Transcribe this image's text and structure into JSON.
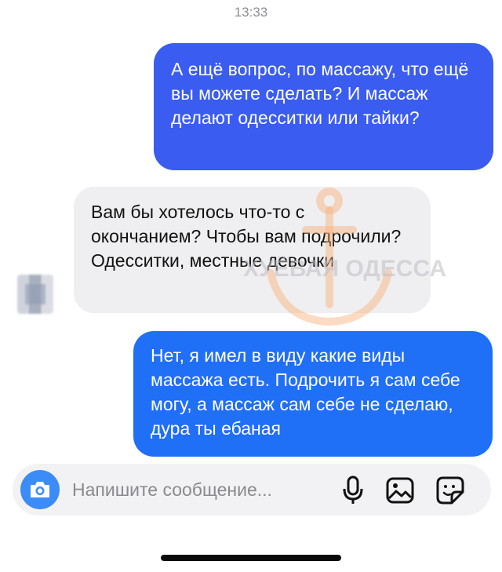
{
  "header": {
    "timestamp": "13:33"
  },
  "messages": [
    {
      "direction": "outgoing",
      "text": "А ещё вопрос, по массажу, что ещё вы можете сделать? И массаж делают одесситки или тайки?",
      "color": "#3b5cf0"
    },
    {
      "direction": "incoming",
      "text": "Вам бы хотелось что-то с окончанием? Чтобы вам подрочили? Одесситки, местные девочки",
      "color": "#efeff1"
    },
    {
      "direction": "outgoing",
      "text": "Нет, я имел в виду какие виды массажа есть. Подрочить я сам себе могу, а массаж сам себе не сделаю, дура ты ебаная",
      "color": "#1f6ff7"
    }
  ],
  "watermark": {
    "text": "ХУЁВАЯ ОДЕССА"
  },
  "composer": {
    "placeholder": "Напишите сообщение...",
    "icons": [
      "camera-icon",
      "microphone-icon",
      "gallery-icon",
      "sticker-icon"
    ],
    "accent": "#3b8cf6"
  }
}
